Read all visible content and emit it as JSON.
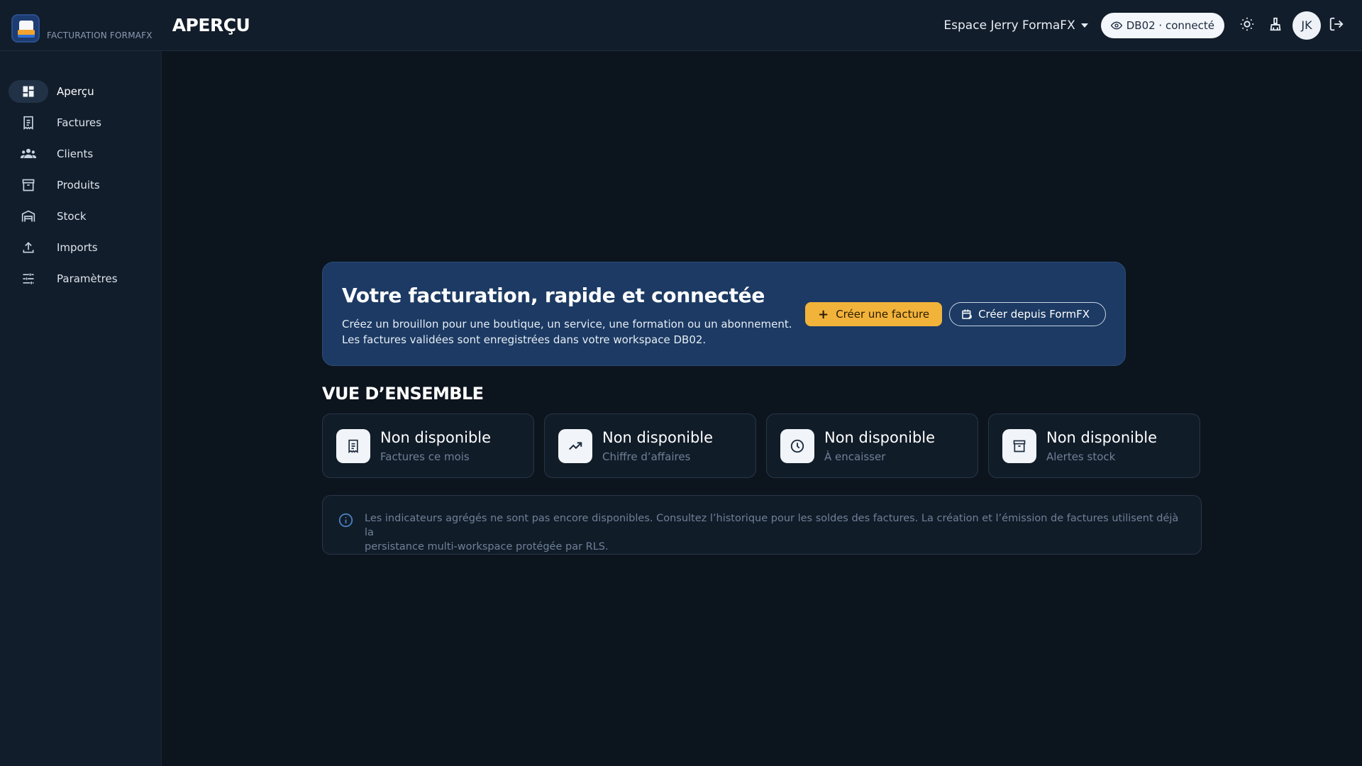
{
  "app": {
    "brand": "FACTURATION FORMAFX",
    "page_title": "APERÇU"
  },
  "header": {
    "workspace": "Espace Jerry FormaFX",
    "db_status": "DB02 · connecté",
    "avatar_initials": "JK"
  },
  "sidebar": {
    "items": [
      {
        "label": "Aperçu",
        "icon": "dashboard-icon",
        "active": true
      },
      {
        "label": "Factures",
        "icon": "invoice-icon"
      },
      {
        "label": "Clients",
        "icon": "people-icon"
      },
      {
        "label": "Produits",
        "icon": "archive-icon"
      },
      {
        "label": "Stock",
        "icon": "warehouse-icon"
      },
      {
        "label": "Imports",
        "icon": "upload-icon"
      },
      {
        "label": "Paramètres",
        "icon": "tune-icon"
      }
    ]
  },
  "hero": {
    "title": "Votre facturation, rapide et connectée",
    "line1": "Créez un brouillon pour une boutique, un service, une formation ou un abonnement.",
    "line2": "Les factures validées sont enregistrées dans votre workspace DB02.",
    "primary_label": "Créer une facture",
    "secondary_label": "Créer depuis FormFX"
  },
  "overview": {
    "title": "VUE D’ENSEMBLE",
    "cards": [
      {
        "value": "Non disponible",
        "label": "Factures ce mois",
        "icon": "invoice-icon"
      },
      {
        "value": "Non disponible",
        "label": "Chiffre d’affaires",
        "icon": "trending-up-icon"
      },
      {
        "value": "Non disponible",
        "label": "À encaisser",
        "icon": "clock-icon"
      },
      {
        "value": "Non disponible",
        "label": "Alertes stock",
        "icon": "archive-icon"
      }
    ]
  },
  "info": {
    "line1": "Les indicateurs agrégés ne sont pas encore disponibles. Consultez l’historique pour les soldes des factures. La création et l’émission de factures utilisent déjà la",
    "line2": "persistance multi-workspace protégée par RLS."
  },
  "colors": {
    "background": "#0c141e",
    "panel": "#121d2b",
    "hero": "#1c3a63",
    "accent": "#f2b33a"
  }
}
